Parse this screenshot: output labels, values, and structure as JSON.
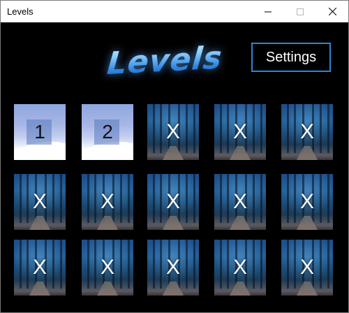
{
  "window": {
    "title": "Levels"
  },
  "header": {
    "logo_text": "Levels",
    "settings_label": "Settings"
  },
  "levels": [
    {
      "label": "1",
      "locked": false
    },
    {
      "label": "2",
      "locked": false
    },
    {
      "label": "X",
      "locked": true
    },
    {
      "label": "X",
      "locked": true
    },
    {
      "label": "X",
      "locked": true
    },
    {
      "label": "X",
      "locked": true
    },
    {
      "label": "X",
      "locked": true
    },
    {
      "label": "X",
      "locked": true
    },
    {
      "label": "X",
      "locked": true
    },
    {
      "label": "X",
      "locked": true
    },
    {
      "label": "X",
      "locked": true
    },
    {
      "label": "X",
      "locked": true
    },
    {
      "label": "X",
      "locked": true
    },
    {
      "label": "X",
      "locked": true
    },
    {
      "label": "X",
      "locked": true
    }
  ]
}
